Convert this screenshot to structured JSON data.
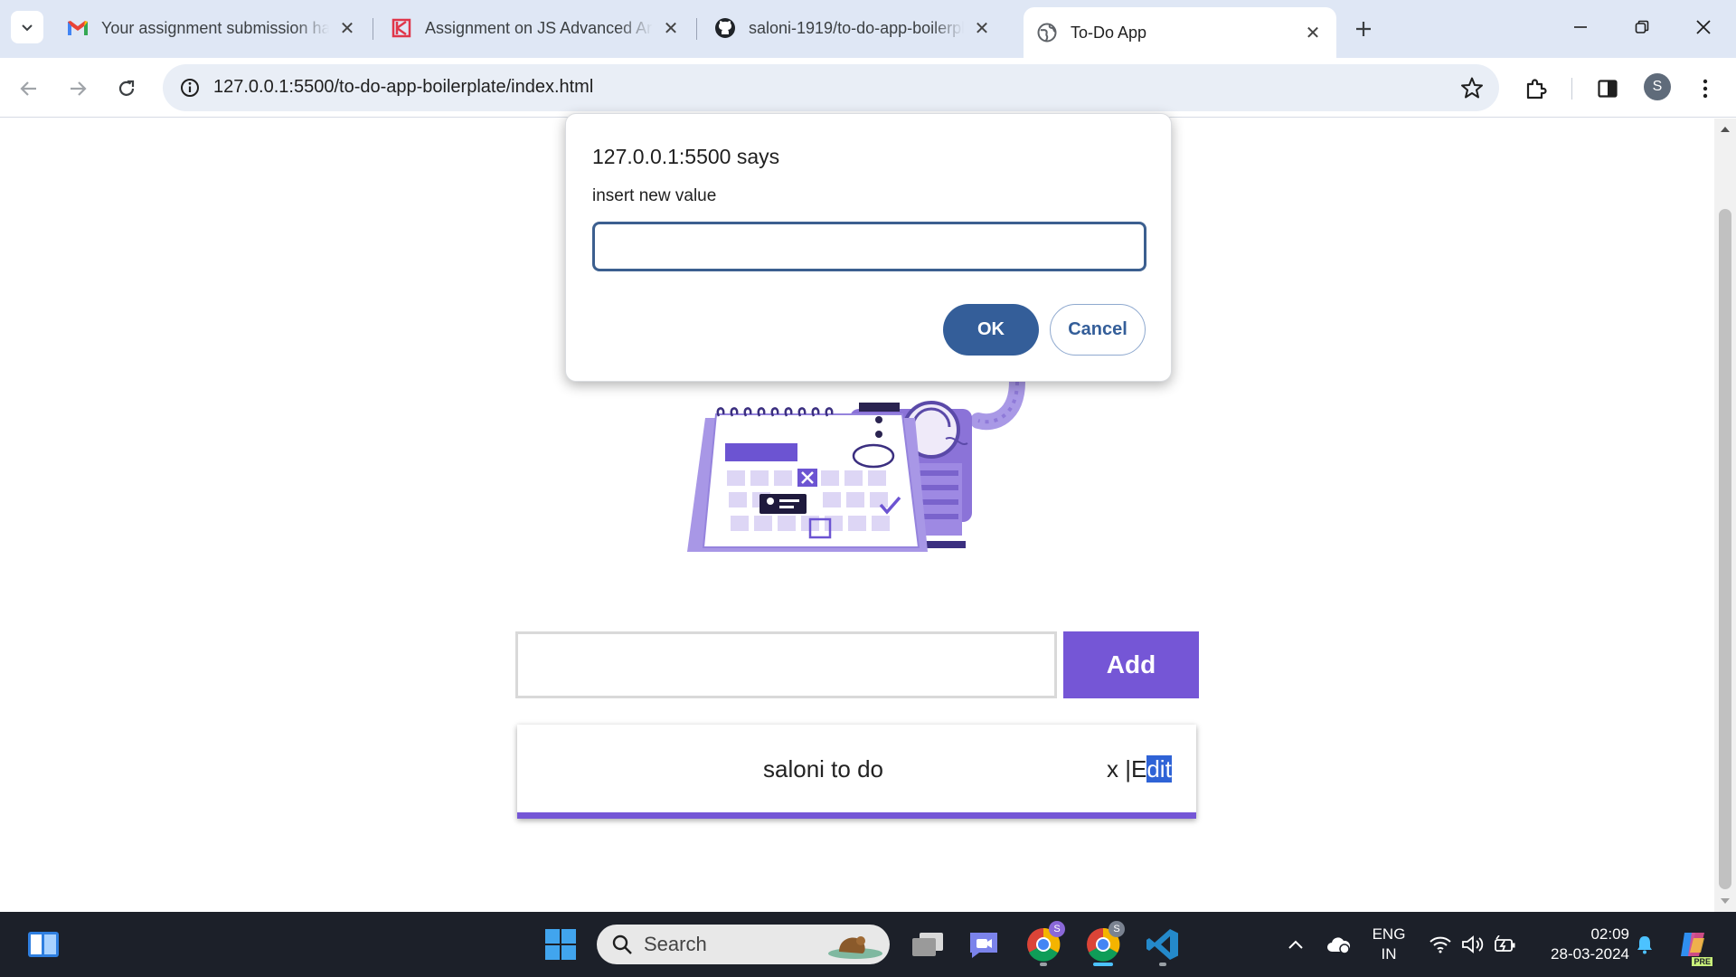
{
  "browser": {
    "tabs": [
      {
        "title": "Your assignment submission ha",
        "icon": "gmail-icon"
      },
      {
        "title": "Assignment on JS Advanced Ar",
        "icon": "k-logo-icon"
      },
      {
        "title": "saloni-1919/to-do-app-boilerpl",
        "icon": "github-icon"
      },
      {
        "title": "To-Do App",
        "icon": "globe-icon",
        "active": true
      }
    ],
    "url": "127.0.0.1:5500/to-do-app-boilerplate/index.html",
    "profile_initial": "S"
  },
  "dialog": {
    "title": "127.0.0.1:5500 says",
    "message": "insert new value",
    "input_value": "",
    "ok_label": "OK",
    "cancel_label": "Cancel"
  },
  "app": {
    "input_value": "",
    "add_label": "Add",
    "todos": [
      {
        "text": "saloni to do",
        "delete_label": "x",
        "separator": "|",
        "edit_prefix": "E",
        "edit_selected": "dit"
      }
    ],
    "accent_color": "#7556d6"
  },
  "taskbar": {
    "search_placeholder": "Search",
    "language": "ENG",
    "region": "IN",
    "time": "02:09",
    "date": "28-03-2024",
    "copilot_badge": "PRE"
  }
}
